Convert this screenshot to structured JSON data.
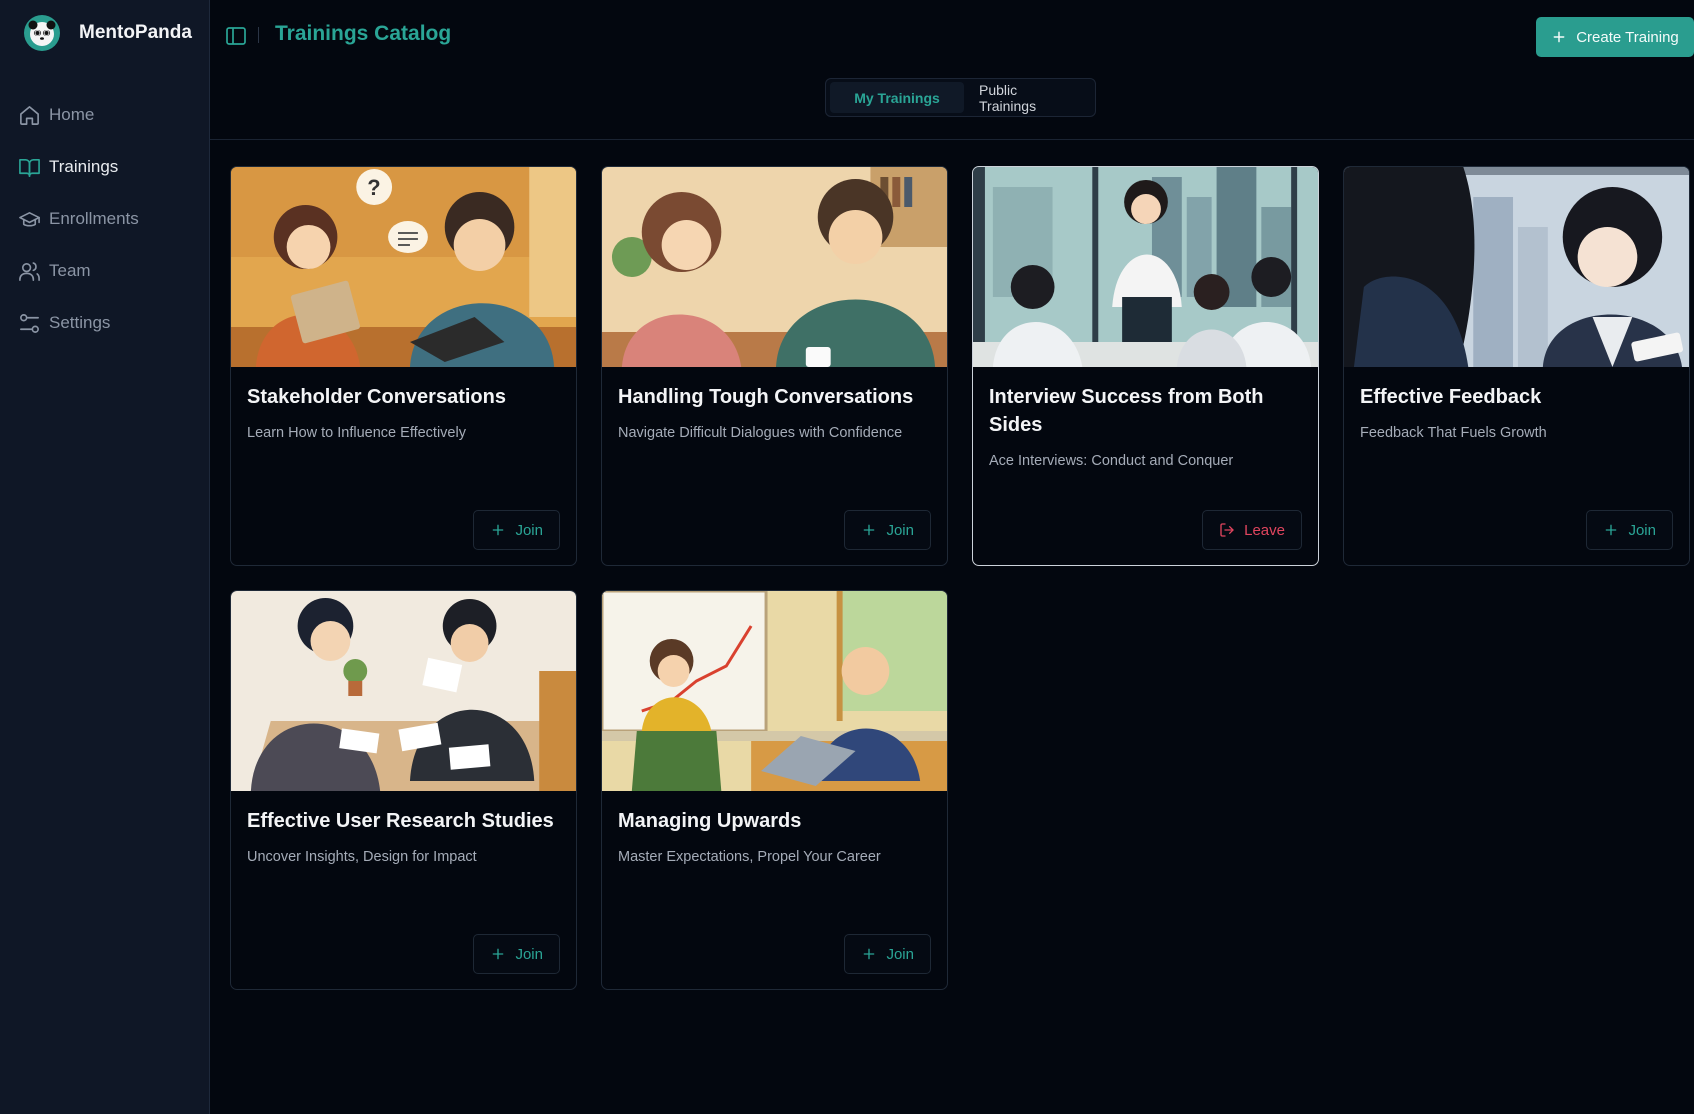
{
  "app": {
    "name": "MentoPanda"
  },
  "sidebar": {
    "items": [
      {
        "label": "Home",
        "icon": "home-icon",
        "active": false
      },
      {
        "label": "Trainings",
        "icon": "book-icon",
        "active": true
      },
      {
        "label": "Enrollments",
        "icon": "graduation-cap-icon",
        "active": false
      },
      {
        "label": "Team",
        "icon": "users-icon",
        "active": false
      },
      {
        "label": "Settings",
        "icon": "sliders-icon",
        "active": false
      }
    ]
  },
  "header": {
    "title": "Trainings Catalog",
    "create_label": "Create Training"
  },
  "tabs": {
    "my_trainings": "My Trainings",
    "public_trainings": "Public Trainings",
    "selected": "My Trainings"
  },
  "colors": {
    "accent": "#2a9d8f",
    "background": "#03070f",
    "sidebar": "#0f1726",
    "danger": "#e0455e"
  },
  "trainings": [
    {
      "title": "Stakeholder Conversations",
      "subtitle": "Learn How to Influence Effectively",
      "action": "Join"
    },
    {
      "title": "Handling Tough Conversations",
      "subtitle": "Navigate Difficult Dialogues with Confidence",
      "action": "Join"
    },
    {
      "title": "Interview Success from Both Sides",
      "subtitle": "Ace Interviews: Conduct and Conquer",
      "action": "Leave"
    },
    {
      "title": "Effective Feedback",
      "subtitle": "Feedback That Fuels Growth",
      "action": "Join"
    },
    {
      "title": "Effective User Research Studies",
      "subtitle": "Uncover Insights, Design for Impact",
      "action": "Join"
    },
    {
      "title": "Managing Upwards",
      "subtitle": "Master Expectations, Propel Your Career",
      "action": "Join"
    }
  ]
}
